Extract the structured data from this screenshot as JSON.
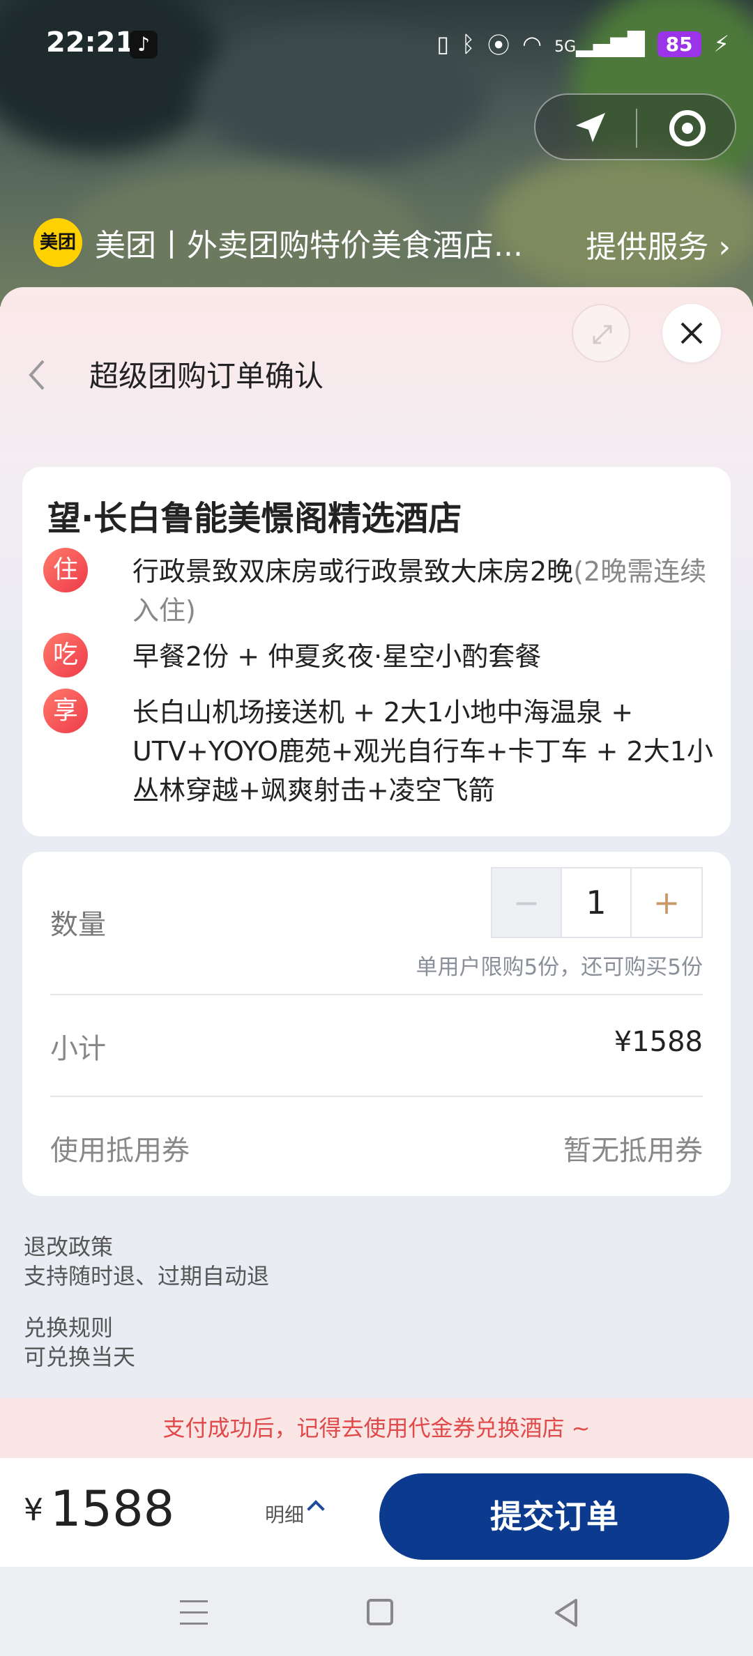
{
  "status_bar": {
    "time": "22:21",
    "app_icon": "tiktok-icon",
    "icons": [
      "vibrate-icon",
      "bluetooth-icon",
      "location-icon",
      "wifi-icon",
      "signal-5g-icon"
    ],
    "network": "5G",
    "battery": "85",
    "battery_color": "#9b34e8"
  },
  "mini_program": {
    "logo_text": "美团",
    "title": "美团丨外卖团购特价美食酒店...",
    "service_link": "提供服务"
  },
  "sheet": {
    "title": "超级团购订单确认"
  },
  "hotel": {
    "name": "望·长白鲁能美憬阁精选酒店",
    "items": [
      {
        "badge": "住",
        "text": "行政景致双床房或行政景致大床房2晚",
        "note": "(2晚需连续入住)"
      },
      {
        "badge": "吃",
        "text": "早餐2份 + 仲夏炙夜·星空小酌套餐",
        "note": ""
      },
      {
        "badge": "享",
        "text": "长白山机场接送机 + 2大1小地中海温泉 + UTV+YOYO鹿苑+观光自行车+卡丁车 + 2大1小丛林穿越+飒爽射击+凌空飞箭",
        "note": ""
      }
    ]
  },
  "order": {
    "quantity_label": "数量",
    "quantity_value": "1",
    "minus": "−",
    "plus": "+",
    "limit_text": "单用户限购5份，还可购买5份",
    "subtotal_label": "小计",
    "subtotal_value": "¥1588",
    "coupon_label": "使用抵用券",
    "coupon_value": "暂无抵用券"
  },
  "policies": [
    {
      "title": "退改政策",
      "text": "支持随时退、过期自动退"
    },
    {
      "title": "兑换规则",
      "text": "可兑换当天"
    }
  ],
  "notice": "支付成功后，记得去使用代金券兑换酒店 ~",
  "footer": {
    "currency": "¥",
    "price": "1588",
    "detail": "明细",
    "submit": "提交订单",
    "submit_color": "#0b3a8e"
  }
}
